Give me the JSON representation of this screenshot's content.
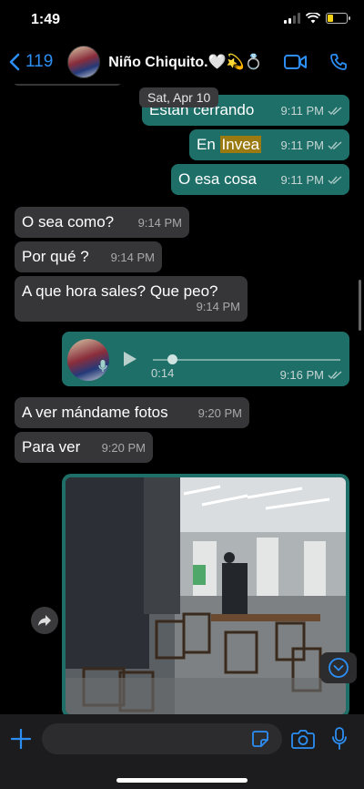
{
  "status": {
    "time": "1:49"
  },
  "header": {
    "back_count": "119",
    "contact_name": "Niño Chiquito.🤍💫💍"
  },
  "chat": {
    "date_separator": "Sat, Apr 10",
    "messages": [
      {
        "dir": "out",
        "text": "Están cerrando",
        "time": "9:11 PM"
      },
      {
        "dir": "out",
        "text_pre": "En ",
        "text_highlight": "Invea",
        "time": "9:11 PM"
      },
      {
        "dir": "out",
        "text": "O esa cosa",
        "time": "9:11 PM"
      },
      {
        "dir": "in",
        "text": "O sea como?",
        "time": "9:14 PM"
      },
      {
        "dir": "in",
        "text": "Por qué ?",
        "time": "9:14 PM"
      },
      {
        "dir": "in",
        "text": "A que hora sales? Que peo?",
        "time": "9:14 PM"
      },
      {
        "dir": "in",
        "text": "A ver mándame fotos",
        "time": "9:20 PM"
      },
      {
        "dir": "in",
        "text": "Para ver",
        "time": "9:20 PM"
      }
    ],
    "voice_note": {
      "duration": "0:14",
      "time": "9:16 PM",
      "progress": 0.1
    }
  },
  "colors": {
    "outgoing": "#1f6f69",
    "incoming": "#363638",
    "accent": "#2c8ef3",
    "highlight": "#9a7a11"
  },
  "icons": [
    "chevron-left-icon",
    "video-call-icon",
    "phone-icon",
    "forward-icon",
    "chevron-down-icon",
    "plus-icon",
    "sticker-icon",
    "camera-icon",
    "microphone-icon",
    "play-icon",
    "double-check-icon"
  ]
}
